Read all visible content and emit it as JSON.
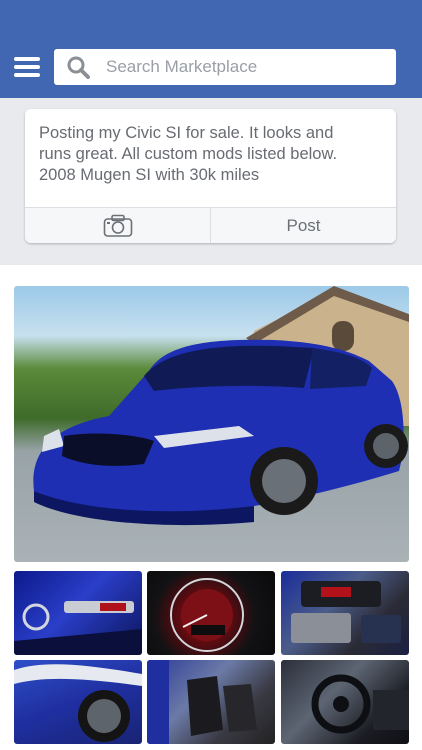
{
  "header": {
    "menu_icon": "hamburger-menu-icon",
    "search": {
      "placeholder": "Search Marketplace",
      "icon": "search-icon"
    },
    "color": "#4167b2"
  },
  "composer": {
    "text": "Posting my Civic SI for sale. It looks and runs great. All custom mods listed below. 2008 Mugen SI with 30k miles",
    "camera_icon": "camera-icon",
    "post_label": "Post"
  },
  "listing": {
    "main_photo": "car-photo-main",
    "thumbnails": [
      "car-photo-front-badge",
      "car-photo-gauge-cluster",
      "car-photo-engine-bay",
      "car-photo-front-wheel",
      "car-photo-interior-seats",
      "car-photo-steering-wheel"
    ]
  }
}
